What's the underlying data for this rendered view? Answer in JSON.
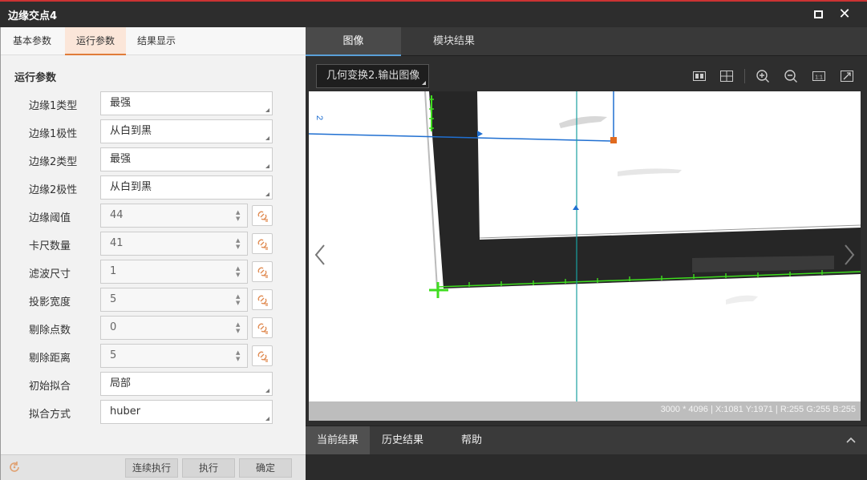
{
  "window": {
    "title": "边缘交点4"
  },
  "left_tabs": [
    {
      "label": "基本参数",
      "active": false
    },
    {
      "label": "运行参数",
      "active": true
    },
    {
      "label": "结果显示",
      "active": false
    }
  ],
  "section_title": "运行参数",
  "params": [
    {
      "label": "边缘1类型",
      "value": "最强"
    },
    {
      "label": "边缘1极性",
      "value": "从白到黑"
    },
    {
      "label": "边缘2类型",
      "value": "最强"
    },
    {
      "label": "边缘2极性",
      "value": "从白到黑"
    },
    {
      "label": "边缘阈值",
      "value": "44"
    },
    {
      "label": "卡尺数量",
      "value": "41"
    },
    {
      "label": "滤波尺寸",
      "value": "1"
    },
    {
      "label": "投影宽度",
      "value": "5"
    },
    {
      "label": "剔除点数",
      "value": "0"
    },
    {
      "label": "剔除距离",
      "value": "5"
    },
    {
      "label": "初始拟合",
      "value": "局部"
    },
    {
      "label": "拟合方式",
      "value": "huber"
    }
  ],
  "footer": {
    "continuous": "连续执行",
    "execute": "执行",
    "confirm": "确定"
  },
  "right_tabs": [
    {
      "label": "图像",
      "active": true
    },
    {
      "label": "模块结果",
      "active": false
    }
  ],
  "image_source": "几何变换2.输出图像",
  "status_text": "3000 * 4096  |  X:1081  Y:1971  |  R:255  G:255  B:255",
  "roi_label": "2",
  "bottom_tabs": [
    {
      "label": "当前结果",
      "active": true
    },
    {
      "label": "历史结果",
      "active": false
    },
    {
      "label": "帮助",
      "active": false
    }
  ],
  "icons": [
    "maximize-icon",
    "close-icon",
    "refresh-icon",
    "link-icon",
    "split-view-icon",
    "grid-view-icon",
    "zoom-in-icon",
    "zoom-out-icon",
    "actual-size-icon",
    "fit-window-icon",
    "prev-image-icon",
    "next-image-icon",
    "collapse-icon"
  ],
  "colors": {
    "accent": "#e07b39",
    "tab_active_bg": "#fbe6d9",
    "edge_green": "#3fdc1f",
    "roi_blue": "#1f6fd1"
  }
}
